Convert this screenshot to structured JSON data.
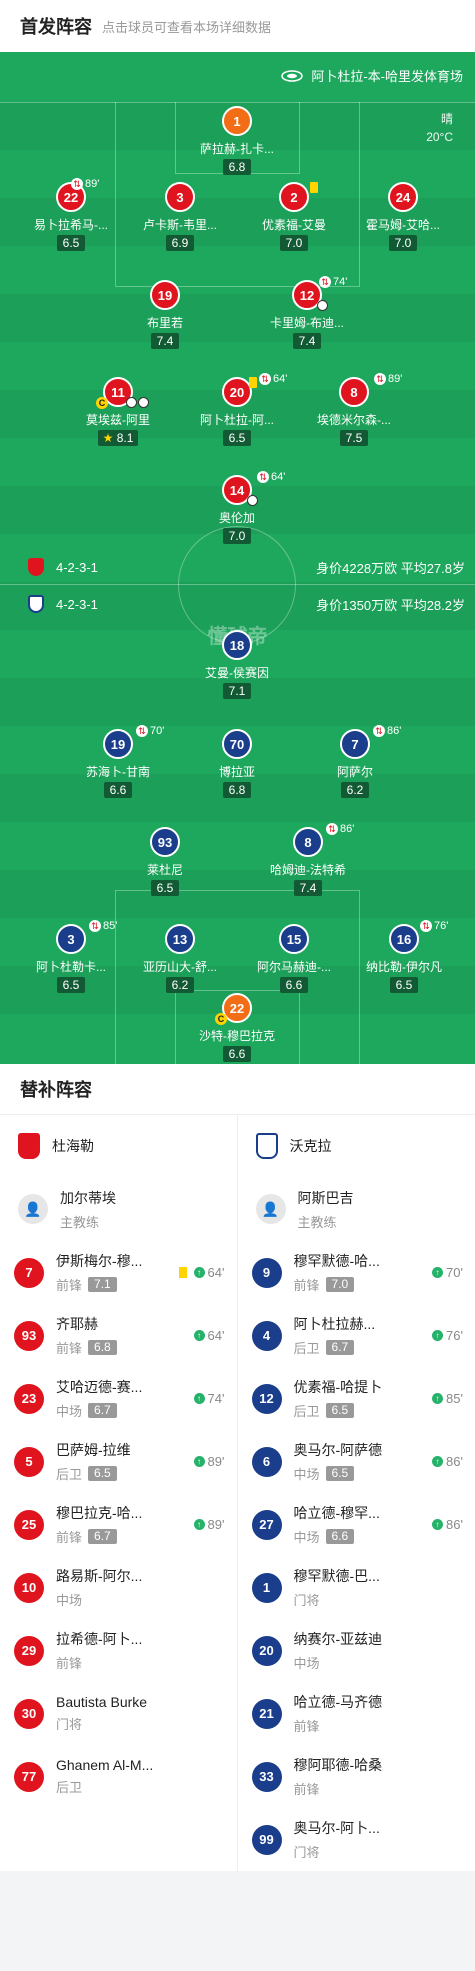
{
  "header": {
    "title": "首发阵容",
    "hint": "点击球员可查看本场详细数据"
  },
  "venue": "阿卜杜拉-本-哈里发体育场",
  "weather": {
    "cond": "晴",
    "temp": "20°C"
  },
  "watermark": "懂球帝",
  "home": {
    "formation": "4-2-3-1",
    "value": "身价4228万欧 平均27.8岁",
    "color": "#e0141e",
    "players": [
      {
        "num": "1",
        "name": "萨拉赫-扎卡...",
        "rating": "6.8",
        "gk": true
      },
      {
        "num": "22",
        "name": "易卜拉希马-...",
        "rating": "6.5",
        "sub": "89'"
      },
      {
        "num": "3",
        "name": "卢卡斯-韦里...",
        "rating": "6.9"
      },
      {
        "num": "2",
        "name": "优素福-艾曼",
        "rating": "7.0"
      },
      {
        "num": "24",
        "name": "霍马姆-艾哈...",
        "rating": "7.0"
      },
      {
        "num": "19",
        "name": "布里若",
        "rating": "7.4"
      },
      {
        "num": "12",
        "name": "卡里姆-布迪...",
        "rating": "7.4",
        "sub": "74'"
      },
      {
        "num": "11",
        "name": "莫埃兹-阿里",
        "rating": "8.1"
      },
      {
        "num": "20",
        "name": "阿卜杜拉-阿...",
        "rating": "6.5",
        "sub": "64'"
      },
      {
        "num": "8",
        "name": "埃德米尔森-...",
        "rating": "7.5",
        "sub": "89'"
      },
      {
        "num": "14",
        "name": "奥伦加",
        "rating": "7.0",
        "sub": "64'"
      }
    ]
  },
  "away": {
    "formation": "4-2-3-1",
    "value": "身价1350万欧 平均28.2岁",
    "color": "#1a3e8c",
    "players": [
      {
        "num": "18",
        "name": "艾曼-侯赛因",
        "rating": "7.1"
      },
      {
        "num": "19",
        "name": "苏海卜-甘南",
        "rating": "6.6",
        "sub": "70'"
      },
      {
        "num": "70",
        "name": "博拉亚",
        "rating": "6.8"
      },
      {
        "num": "7",
        "name": "阿萨尔",
        "rating": "6.2",
        "sub": "86'"
      },
      {
        "num": "93",
        "name": "莱杜尼",
        "rating": "6.5"
      },
      {
        "num": "8",
        "name": "哈姆迪-法特希",
        "rating": "7.4",
        "sub": "86'"
      },
      {
        "num": "3",
        "name": "阿卜杜勒卡...",
        "rating": "6.5",
        "sub": "85'"
      },
      {
        "num": "13",
        "name": "亚历山大-舒...",
        "rating": "6.2"
      },
      {
        "num": "15",
        "name": "阿尔马赫迪-...",
        "rating": "6.6"
      },
      {
        "num": "16",
        "name": "纳比勒-伊尔凡",
        "rating": "6.5",
        "sub": "76'"
      },
      {
        "num": "22",
        "name": "沙特-穆巴拉克",
        "rating": "6.6",
        "gk": true
      }
    ]
  },
  "subs": {
    "title": "替补阵容",
    "home": {
      "team": "杜海勒",
      "coach": "加尔蒂埃",
      "coach_role": "主教练",
      "list": [
        {
          "num": "7",
          "name": "伊斯梅尔-穆...",
          "pos": "前锋",
          "rating": "7.1",
          "time": "64'",
          "card": true
        },
        {
          "num": "93",
          "name": "齐耶赫",
          "pos": "前锋",
          "rating": "6.8",
          "time": "64'"
        },
        {
          "num": "23",
          "name": "艾哈迈德-赛...",
          "pos": "中场",
          "rating": "6.7",
          "time": "74'"
        },
        {
          "num": "5",
          "name": "巴萨姆-拉维",
          "pos": "后卫",
          "rating": "6.5",
          "time": "89'"
        },
        {
          "num": "25",
          "name": "穆巴拉克-哈...",
          "pos": "前锋",
          "rating": "6.7",
          "time": "89'"
        },
        {
          "num": "10",
          "name": "路易斯-阿尔...",
          "pos": "中场"
        },
        {
          "num": "29",
          "name": "拉希德-阿卜...",
          "pos": "前锋"
        },
        {
          "num": "30",
          "name": "Bautista Burke",
          "pos": "门将"
        },
        {
          "num": "77",
          "name": "Ghanem Al-M...",
          "pos": "后卫"
        }
      ]
    },
    "away": {
      "team": "沃克拉",
      "coach": "阿斯巴吉",
      "coach_role": "主教练",
      "list": [
        {
          "num": "9",
          "name": "穆罕默德-哈...",
          "pos": "前锋",
          "rating": "7.0",
          "time": "70'"
        },
        {
          "num": "4",
          "name": "阿卜杜拉赫...",
          "pos": "后卫",
          "rating": "6.7",
          "time": "76'"
        },
        {
          "num": "12",
          "name": "优素福-哈提卜",
          "pos": "后卫",
          "rating": "6.5",
          "time": "85'"
        },
        {
          "num": "6",
          "name": "奥马尔-阿萨德",
          "pos": "中场",
          "rating": "6.5",
          "time": "86'"
        },
        {
          "num": "27",
          "name": "哈立德-穆罕...",
          "pos": "中场",
          "rating": "6.6",
          "time": "86'"
        },
        {
          "num": "1",
          "name": "穆罕默德-巴...",
          "pos": "门将"
        },
        {
          "num": "20",
          "name": "纳赛尔-亚兹迪",
          "pos": "中场"
        },
        {
          "num": "21",
          "name": "哈立德-马齐德",
          "pos": "前锋"
        },
        {
          "num": "33",
          "name": "穆阿耶德-哈桑",
          "pos": "前锋"
        },
        {
          "num": "99",
          "name": "奥马尔-阿卜...",
          "pos": "门将"
        }
      ]
    }
  }
}
